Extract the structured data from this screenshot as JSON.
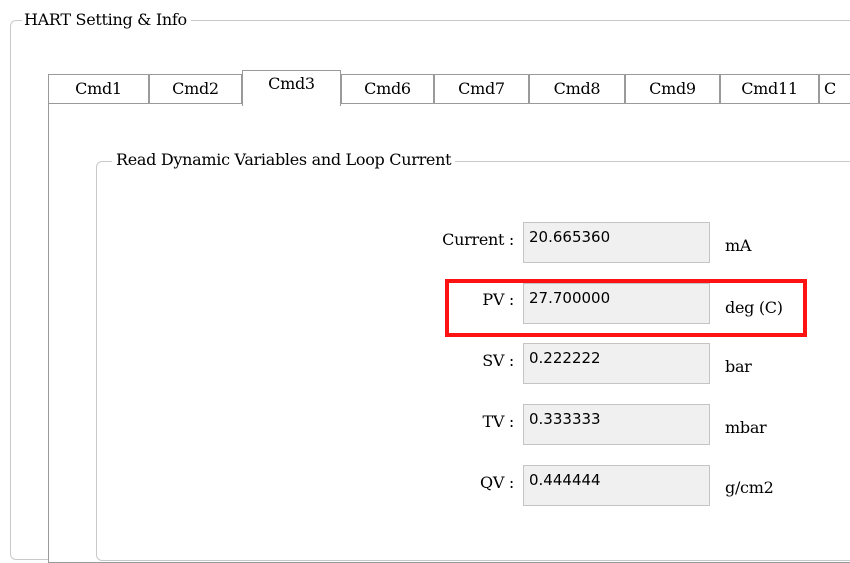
{
  "group": {
    "title": "HART Setting & Info"
  },
  "tabs": [
    {
      "label": "Cmd1",
      "active": false
    },
    {
      "label": "Cmd2",
      "active": false
    },
    {
      "label": "Cmd3",
      "active": true
    },
    {
      "label": "Cmd6",
      "active": false
    },
    {
      "label": "Cmd7",
      "active": false
    },
    {
      "label": "Cmd8",
      "active": false
    },
    {
      "label": "Cmd9",
      "active": false
    },
    {
      "label": "Cmd11",
      "active": false
    },
    {
      "label": "C",
      "active": false
    }
  ],
  "panel": {
    "title": "Read Dynamic Variables and Loop Current",
    "fields": {
      "current": {
        "label": "Current :",
        "value": "20.665360",
        "unit": "mA"
      },
      "pv": {
        "label": "PV :",
        "value": "27.700000",
        "unit": "deg (C)"
      },
      "sv": {
        "label": "SV :",
        "value": "0.222222",
        "unit": "bar"
      },
      "tv": {
        "label": "TV :",
        "value": "0.333333",
        "unit": "mbar"
      },
      "qv": {
        "label": "QV :",
        "value": "0.444444",
        "unit": "g/cm2"
      }
    }
  },
  "highlight": {
    "color": "#ff1212",
    "target": "pv"
  }
}
